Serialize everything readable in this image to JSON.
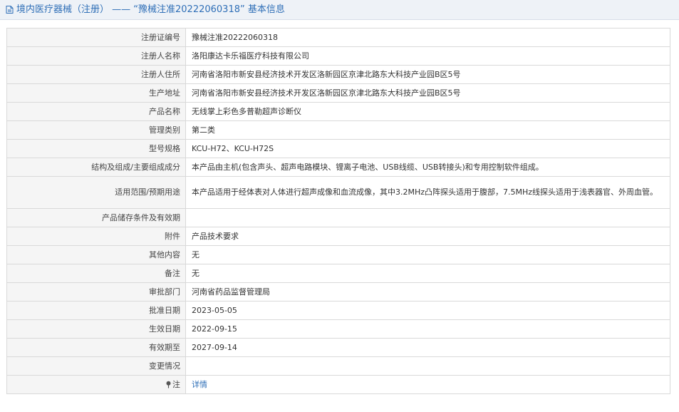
{
  "header": {
    "title": "境内医疗器械（注册） —— “豫械注准20222060318” 基本信息"
  },
  "rows": [
    {
      "label": "注册证编号",
      "value": "豫械注准20222060318"
    },
    {
      "label": "注册人名称",
      "value": "洛阳康达卡乐福医疗科技有限公司"
    },
    {
      "label": "注册人住所",
      "value": "河南省洛阳市新安县经济技术开发区洛新园区京津北路东大科技产业园B区5号"
    },
    {
      "label": "生产地址",
      "value": "河南省洛阳市新安县经济技术开发区洛新园区京津北路东大科技产业园B区5号"
    },
    {
      "label": "产品名称",
      "value": "无线掌上彩色多普勒超声诊断仪"
    },
    {
      "label": "管理类别",
      "value": "第二类"
    },
    {
      "label": "型号规格",
      "value": "KCU-H72、KCU-H72S"
    },
    {
      "label": "结构及组成/主要组成成分",
      "value": "本产品由主机(包含声头、超声电路模块、锂离子电池、USB线缆、USB转接头)和专用控制软件组成。"
    },
    {
      "label": "适用范围/预期用途",
      "value": "本产品适用于经体表对人体进行超声成像和血流成像，其中3.2MHz凸阵探头适用于腹部，7.5MHz线探头适用于浅表器官、外周血管。"
    },
    {
      "label": "产品储存条件及有效期",
      "value": ""
    },
    {
      "label": "附件",
      "value": "产品技术要求"
    },
    {
      "label": "其他内容",
      "value": "无"
    },
    {
      "label": "备注",
      "value": "无"
    },
    {
      "label": "审批部门",
      "value": "河南省药品监督管理局"
    },
    {
      "label": "批准日期",
      "value": "2023-05-05"
    },
    {
      "label": "生效日期",
      "value": "2022-09-15"
    },
    {
      "label": "有效期至",
      "value": "2027-09-14"
    },
    {
      "label": "变更情况",
      "value": ""
    },
    {
      "label": "注",
      "value": "详情"
    }
  ],
  "icons": {
    "title": "document-icon",
    "note": "pin-icon"
  },
  "colors": {
    "accent": "#2f6fb7",
    "header_bg": "#eef2f7",
    "label_bg": "#f5f5f5",
    "border": "#d9d9d9"
  }
}
